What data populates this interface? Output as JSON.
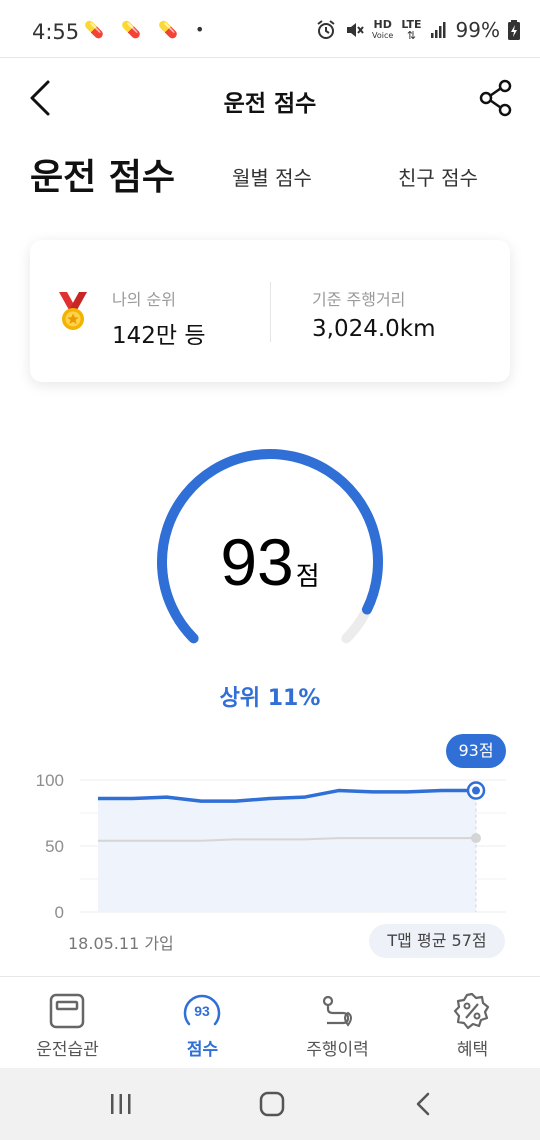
{
  "status_bar": {
    "time": "4:55",
    "left_icons": "💊 💊 💊 •",
    "hd_label": "HD",
    "voice_label": "Voice",
    "lte_label": "LTE",
    "battery": "99%"
  },
  "header": {
    "title": "운전 점수"
  },
  "tabs": {
    "main": "운전 점수",
    "monthly": "월별 점수",
    "friends": "친구 점수"
  },
  "summary_card": {
    "rank_label": "나의 순위",
    "rank_value": "142만 등",
    "distance_label": "기준 주행거리",
    "distance_value": "3,024.0km"
  },
  "gauge": {
    "score": "93",
    "unit": "점",
    "rank_text": "상위 11%",
    "fraction": 0.93
  },
  "chart_data": {
    "type": "line",
    "y_ticks": [
      "100",
      "50",
      "0"
    ],
    "ylim": [
      0,
      100
    ],
    "series": [
      {
        "values": [
          86,
          86,
          87,
          84,
          84,
          86,
          87,
          92,
          91,
          91,
          92,
          92
        ]
      },
      {
        "values": [
          54,
          54,
          54,
          54,
          55,
          55,
          55,
          56,
          56,
          56,
          56,
          56
        ]
      }
    ],
    "latest_badge": "93점",
    "joined_label": "18.05.11 가입",
    "average_label": "T맵 평균 57점",
    "colors": {
      "primary": "#2f6fd6",
      "average": "#d5d5d5"
    }
  },
  "bottom_nav": {
    "items": [
      {
        "label": "운전습관",
        "icon": "driving-habit-icon"
      },
      {
        "label": "점수",
        "icon": "score-icon",
        "badge": "93"
      },
      {
        "label": "주행이력",
        "icon": "route-history-icon"
      },
      {
        "label": "혜택",
        "icon": "discount-icon"
      }
    ]
  },
  "colors": {
    "accent": "#2f6fd6"
  }
}
